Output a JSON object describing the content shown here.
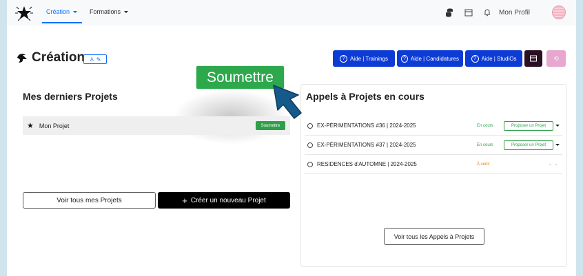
{
  "nav": {
    "items": [
      {
        "label": "Création",
        "active": true
      },
      {
        "label": "Formations",
        "active": false
      }
    ],
    "profile_label": "Mon Profil"
  },
  "header": {
    "title": "Création"
  },
  "help_buttons": [
    {
      "label": "Aide | Trainings"
    },
    {
      "label": "Aide | Candidatures"
    },
    {
      "label": "Aide | StudiOs"
    }
  ],
  "projects": {
    "title": "Mes derniers Projets",
    "items": [
      {
        "name": "Mon Projet",
        "action": "Soumettre"
      }
    ],
    "view_all_label": "Voir tous mes Projets",
    "create_label": "Créer un nouveau Projet"
  },
  "calls": {
    "title": "Appels à Projets en cours",
    "items": [
      {
        "title": "EX-PÉRIMENTATIONS #36  |  2024-2025",
        "status": "En cours",
        "action": "Proposer un Projet"
      },
      {
        "title": "EX-PÉRIMENTATIONS #37  |  2024-2025",
        "status": "En cours",
        "action": "Proposer un Projet"
      },
      {
        "title": "RESIDENCES d'AUTOMNE  |  2024-2025",
        "status": "À venir",
        "action": "- -"
      }
    ],
    "view_all_label": "Voir tous les Appels à Projets"
  },
  "callout": {
    "label": "Soumettre"
  },
  "colors": {
    "primary": "#0d3bd6",
    "success": "#2e9f4a",
    "warning": "#e08a00",
    "accent_nav": "#0d6efd",
    "background": "#cfe4ed"
  }
}
